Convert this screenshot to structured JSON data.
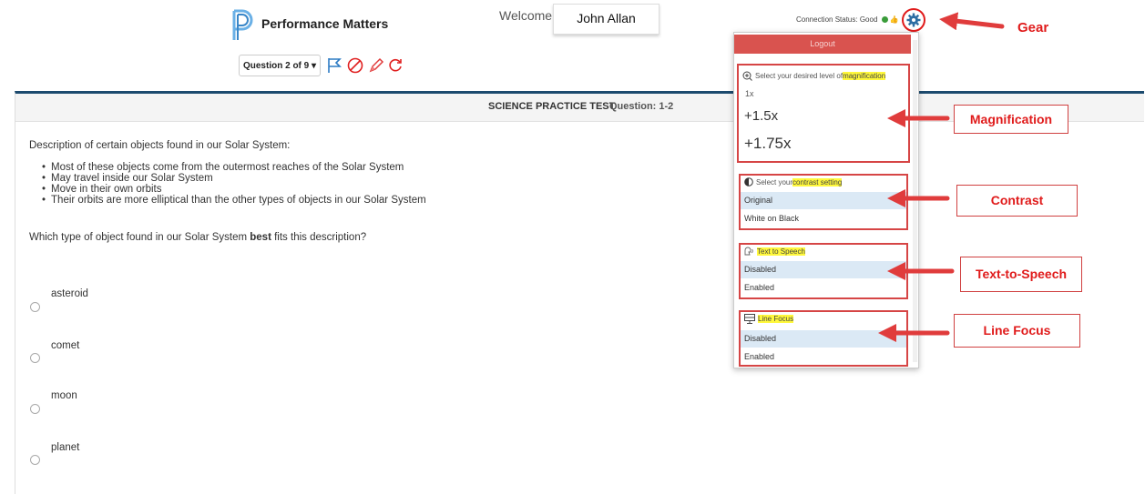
{
  "header": {
    "brand": "Performance Matters",
    "welcome": "Welcome,",
    "user_name": "John Allan",
    "connection_status": "Connection Status: Good"
  },
  "toolbar": {
    "question_nav": "Question 2 of 9 ▾",
    "icons": [
      "flag-icon",
      "cancel-icon",
      "pencil-icon",
      "refresh-icon"
    ]
  },
  "test": {
    "title": "SCIENCE PRACTICE TEST",
    "question_label": "Question: 1-2",
    "description": "Description of certain objects found in our Solar System:",
    "bullets": [
      "Most of these objects come from the outermost reaches of the Solar System",
      "May travel inside our Solar System",
      "Move in their own orbits",
      "Their orbits are more elliptical than the other types of objects in our Solar System"
    ],
    "question_pre": "Which type of object found in our Solar System ",
    "question_bold": "best",
    "question_post": " fits this description?",
    "choices": [
      "asteroid",
      "comet",
      "moon",
      "planet"
    ]
  },
  "settings_menu": {
    "logout": "Logout",
    "magnification": {
      "title_pre": "Select your desired level of ",
      "title_highlight": "magnification",
      "options": [
        "1x",
        "+1.5x",
        "+1.75x"
      ]
    },
    "contrast": {
      "title_pre": "Select your ",
      "title_highlight": "contrast setting",
      "options": [
        "Original",
        "White on Black"
      ],
      "selected": "Original"
    },
    "tts": {
      "title_highlight": "Text to Speech",
      "options": [
        "Disabled",
        "Enabled"
      ],
      "selected": "Disabled"
    },
    "line_focus": {
      "title_highlight": "Line Focus",
      "options": [
        "Disabled",
        "Enabled"
      ],
      "selected": "Disabled"
    }
  },
  "annotations": {
    "gear": "Gear",
    "magnification": "Magnification",
    "contrast": "Contrast",
    "tts": "Text-to-Speech",
    "line_focus": "Line Focus"
  },
  "colors": {
    "accent_red": "#e01b1b",
    "header_bar": "#1c4a6e",
    "logout_red": "#d9534f",
    "selected_row": "#dbe9f5",
    "highlight": "#fff83c"
  }
}
